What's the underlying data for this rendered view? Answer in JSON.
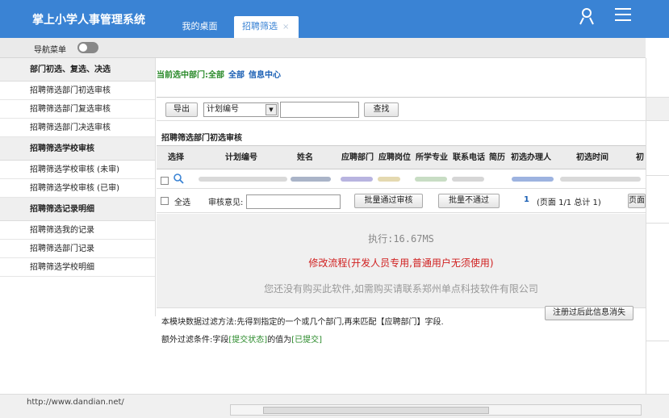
{
  "app": {
    "title": "掌上小学人事管理系统"
  },
  "tabs": [
    {
      "label": "我的桌面"
    },
    {
      "label": "招聘筛选",
      "close": "×"
    }
  ],
  "nav": {
    "label": "导航菜单"
  },
  "sidebar": {
    "items": [
      {
        "label": "部门初选、复选、决选",
        "type": "group"
      },
      {
        "label": "招聘筛选部门初选审核"
      },
      {
        "label": "招聘筛选部门复选审核"
      },
      {
        "label": "招聘筛选部门决选审核"
      },
      {
        "label": "招聘筛选学校审核",
        "type": "group"
      },
      {
        "label": "招聘筛选学校审核 (未审)"
      },
      {
        "label": "招聘筛选学校审核 (已审)"
      },
      {
        "label": "招聘筛选记录明细",
        "type": "group"
      },
      {
        "label": "招聘筛选我的记录"
      },
      {
        "label": "招聘筛选部门记录"
      },
      {
        "label": "招聘筛选学校明细"
      }
    ]
  },
  "crumb": {
    "text": "当前选中部门:全部",
    "link1": "全部",
    "link2": "信息中心"
  },
  "toolbar": {
    "export": "导出",
    "select_value": "计划编号",
    "search_value": "",
    "search": "查找"
  },
  "section": {
    "title": "招聘筛选部门初选审核"
  },
  "table": {
    "headers": [
      "选择",
      "计划编号",
      "姓名",
      "应聘部门",
      "应聘岗位",
      "所学专业",
      "联系电话",
      "简历",
      "初选办理人",
      "初选时间",
      "初"
    ]
  },
  "actions": {
    "select_all": "全选",
    "opinion_label": "审核意见:",
    "opinion_value": "",
    "approve": "批量通过审核",
    "reject": "批量不通过",
    "page_num": "1",
    "page_info": "(页面 1/1  总计 1)",
    "page_btn": "页面"
  },
  "info": {
    "exec": "执行:16.67MS",
    "modify": "修改流程(开发人员专用,普通用户无须使用)",
    "notice": "您还没有购买此软件,如需购买请联系郑州单点科技软件有限公司"
  },
  "filter": {
    "line1": "本模块数据过滤方法:先得到指定的一个或几个部门,再来匹配【应聘部门】字段.",
    "line2_prefix": "额外过滤条件:字段",
    "line2_field": "[提交状态]",
    "line2_mid": "的值为",
    "line2_value": "[已提交]",
    "dismiss": "注册过后此信息消失"
  },
  "status": {
    "url": "http://www.dandian.net/"
  },
  "colors": {
    "topbar": "#3a83d4",
    "link": "#1a5fb4",
    "green": "#2a8a2a",
    "red": "#d02020"
  }
}
